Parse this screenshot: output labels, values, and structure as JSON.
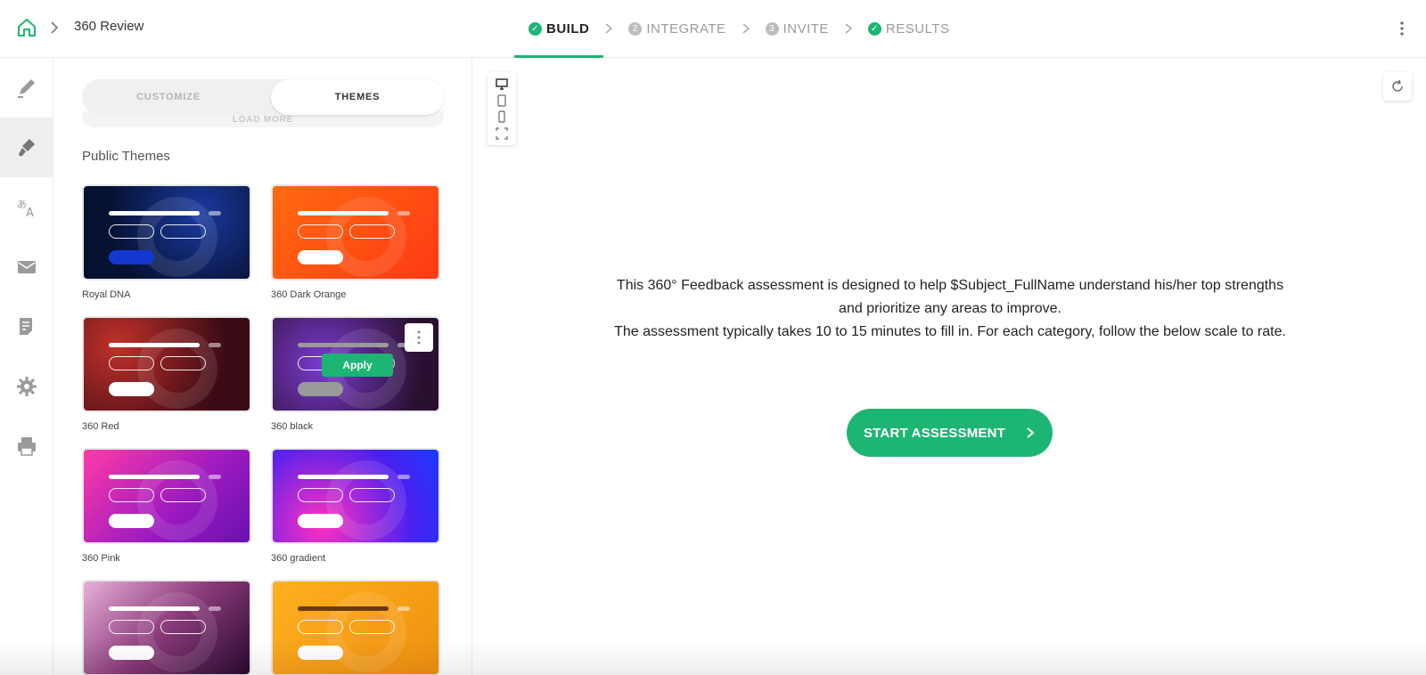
{
  "header": {
    "breadcrumb_title": "360 Review",
    "steps": [
      {
        "label": "BUILD",
        "badge": "",
        "state": "done-active"
      },
      {
        "label": "INTEGRATE",
        "badge": "2",
        "state": "pending"
      },
      {
        "label": "INVITE",
        "badge": "3",
        "state": "pending"
      },
      {
        "label": "RESULTS",
        "badge": "",
        "state": "done"
      }
    ]
  },
  "rail": {
    "items": [
      "pencil-icon",
      "paint-brush-icon",
      "translate-icon",
      "mail-icon",
      "report-icon",
      "gear-icon",
      "printer-icon"
    ],
    "active_index": 1
  },
  "panel": {
    "tabs": {
      "customize": "CUSTOMIZE",
      "themes": "THEMES"
    },
    "load_more": "LOAD MORE",
    "section_title": "Public Themes",
    "themes": [
      {
        "name": "Royal DNA",
        "bg": "#0a1a4a",
        "accent": "#1238d0"
      },
      {
        "name": "360 Dark Orange",
        "bg": "#ff4e12",
        "accent": "#ffffff"
      },
      {
        "name": "360 Red",
        "bg": "#6b1414",
        "accent": "#ffffff"
      },
      {
        "name": "360 black",
        "bg": "#3a2060",
        "accent": "#9a9a9a"
      },
      {
        "name": "360 Pink",
        "bg": "#e0309a",
        "accent": "#ffffff"
      },
      {
        "name": "360 gradient",
        "bg": "#3a1ee0",
        "accent": "#ffffff"
      },
      {
        "name": "",
        "bg": "#8a3a7a",
        "accent": "#ffffff"
      },
      {
        "name": "",
        "bg": "#f0a21a",
        "accent": "#ffffff"
      }
    ],
    "apply_label": "Apply"
  },
  "preview": {
    "intro_line1": "This 360° Feedback assessment is designed to help  $Subject_FullName   understand his/her top strengths and prioritize any areas to improve.",
    "intro_line2": "The assessment typically takes 10 to 15 minutes to fill in. For each category, follow the below scale to rate.",
    "start_label": "START ASSESSMENT"
  },
  "colors": {
    "accent": "#1db574"
  }
}
